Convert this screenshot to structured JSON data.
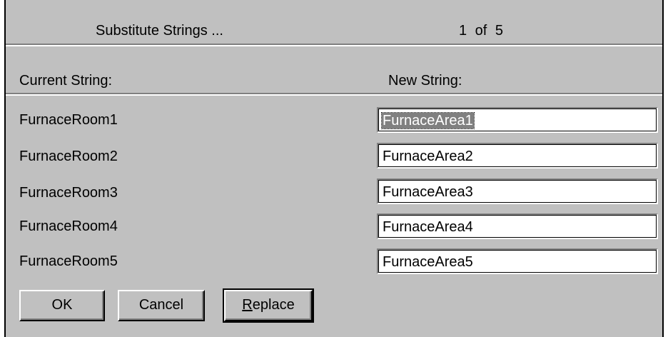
{
  "header": {
    "title": "Substitute Strings ...",
    "page_indicator": "1 of  5"
  },
  "columns": {
    "current": "Current String:",
    "new": "New String:"
  },
  "rows": [
    {
      "current": "FurnaceRoom1",
      "new": "FurnaceArea1",
      "selected": true
    },
    {
      "current": "FurnaceRoom2",
      "new": "FurnaceArea2",
      "selected": false
    },
    {
      "current": "FurnaceRoom3",
      "new": "FurnaceArea3",
      "selected": false
    },
    {
      "current": "FurnaceRoom4",
      "new": "FurnaceArea4",
      "selected": false
    },
    {
      "current": "FurnaceRoom5",
      "new": "FurnaceArea5",
      "selected": false
    }
  ],
  "buttons": {
    "ok": "OK",
    "cancel": "Cancel",
    "replace_mnemonic": "R",
    "replace_rest": "eplace"
  },
  "colors": {
    "dialog_bg": "#c0c0c0",
    "selection_bg": "#808080"
  }
}
